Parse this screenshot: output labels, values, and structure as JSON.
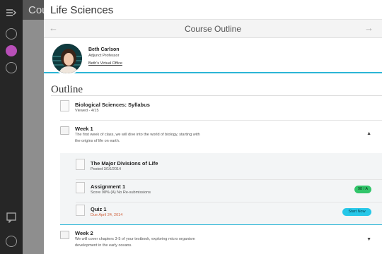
{
  "app": {
    "under_title": "Cou",
    "course_title": "Life Sciences",
    "section_title": "Course Outline"
  },
  "instructor": {
    "name": "Beth Carlson",
    "role": "Adjunct Professor",
    "office_link": "Beth's Virtual Office"
  },
  "outline": {
    "heading": "Outline",
    "syllabus": {
      "title": "Biological Sciences: Syllabus",
      "meta": "Viewed - 4/15"
    },
    "week1": {
      "title": "Week 1",
      "description": "The first week of class, we will dive into the world of biology, starting with the origins of life on earth."
    },
    "items": [
      {
        "title": "The Major Divisions of Life",
        "meta": "Posted 3/16/2014"
      },
      {
        "title": "Assignment 1",
        "meta": "Score 98% (A) No Re-submissions",
        "badge": "98 / A"
      },
      {
        "title": "Quiz 1",
        "meta": "Due April 24, 2014",
        "badge": "Start Now"
      }
    ],
    "week2": {
      "title": "Week 2",
      "description": "We will cover chapters 3-5 of your textbook, exploring micro organism development in the early oceans."
    }
  },
  "colors": {
    "accent": "#2bb5d6",
    "score_badge": "#31c56a",
    "start_badge": "#26c7e8",
    "due_text": "#d0603a",
    "active_rail": "#b84fb8"
  }
}
